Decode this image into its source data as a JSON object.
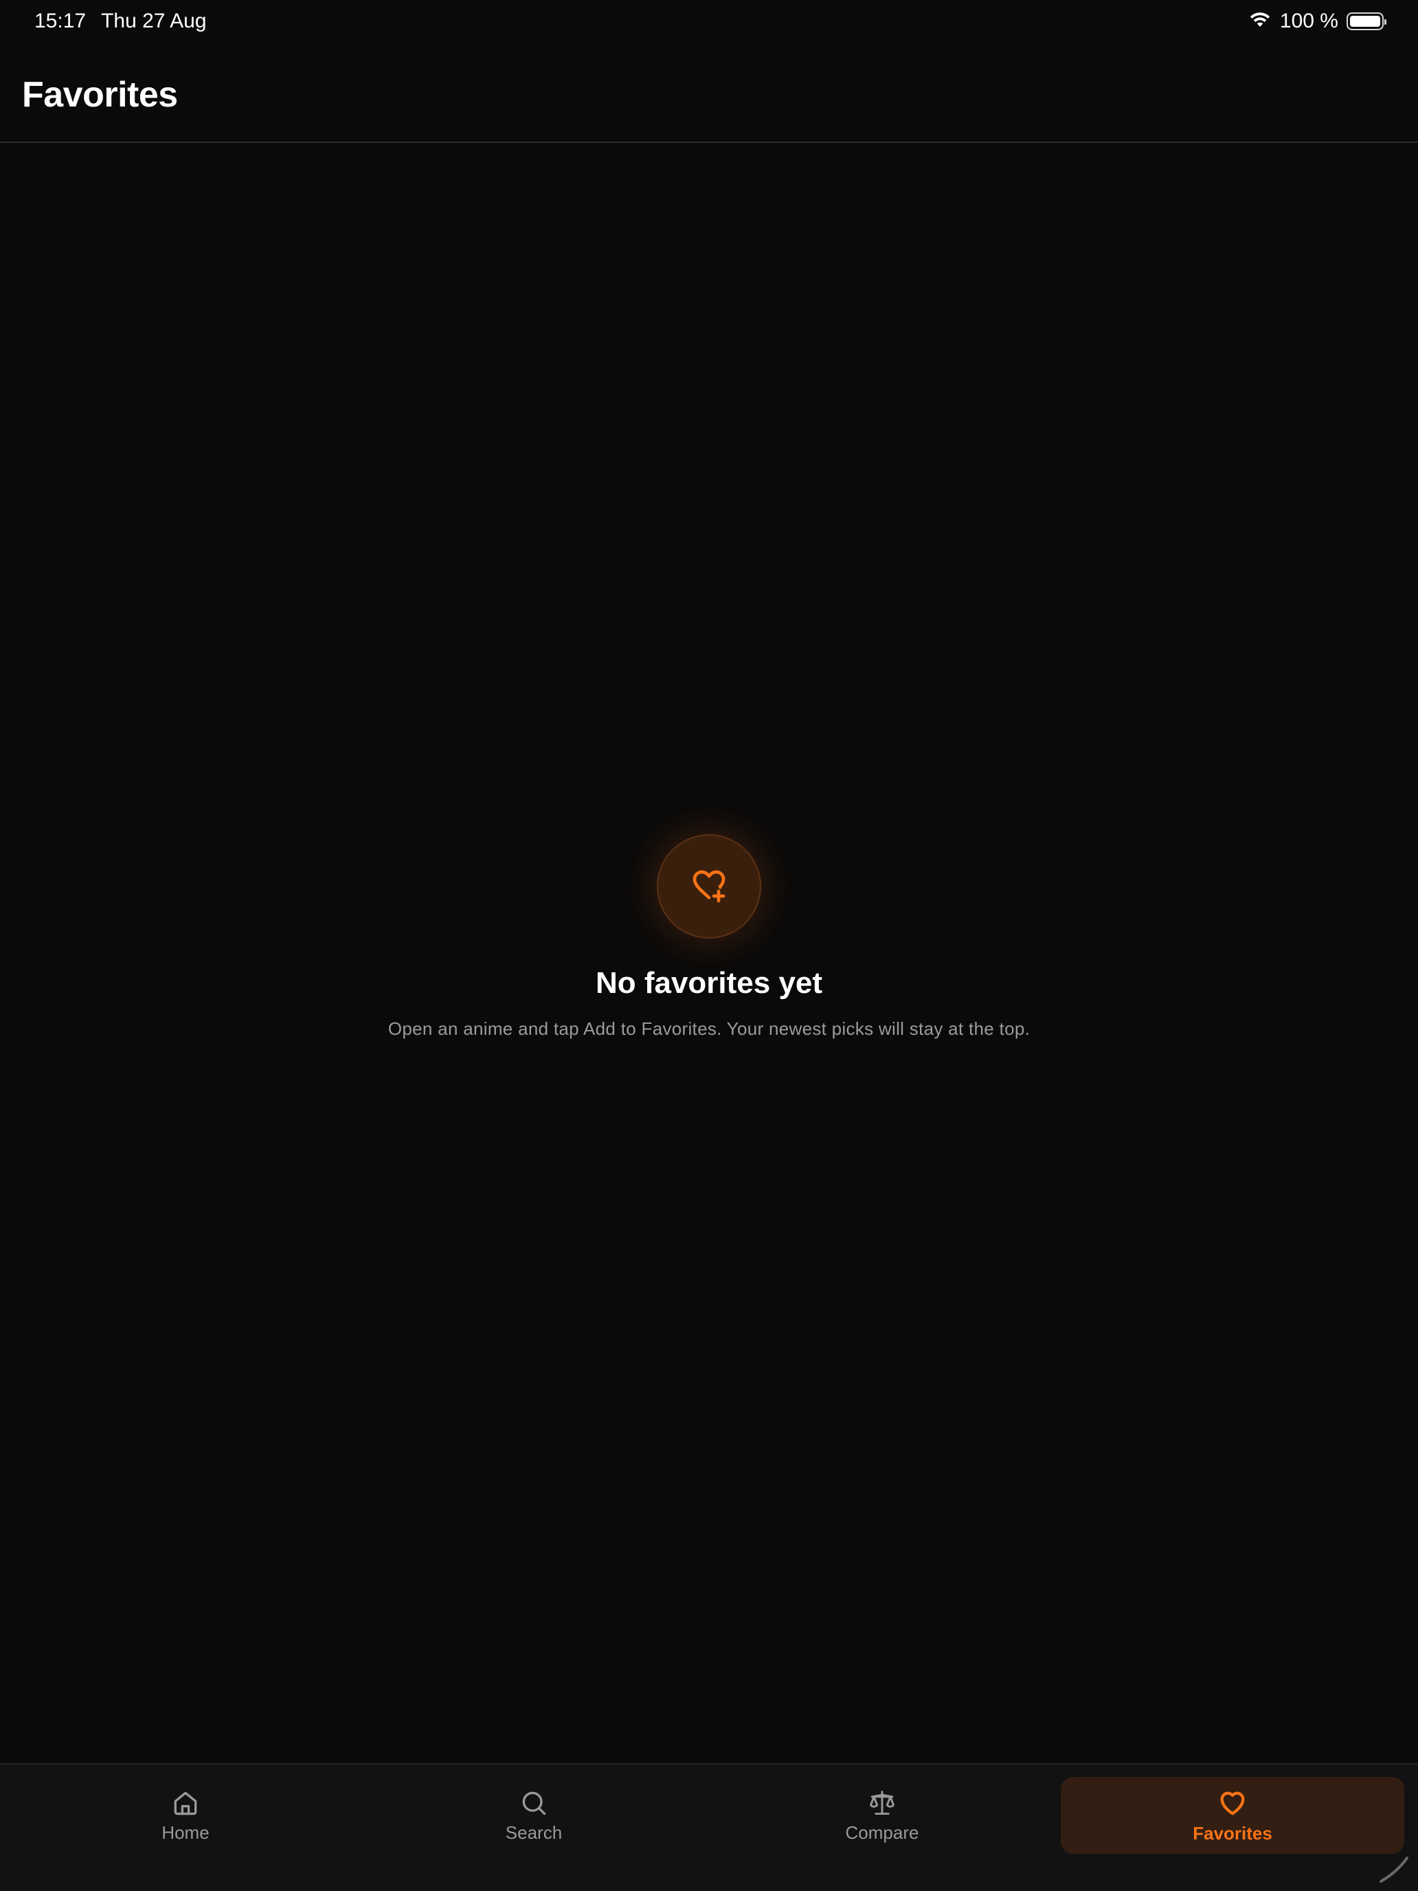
{
  "status_bar": {
    "time": "15:17",
    "date": "Thu 27 Aug",
    "battery_text": "100 %",
    "battery_level": 1.0,
    "wifi_icon": "wifi-icon",
    "battery_icon": "battery-icon"
  },
  "header": {
    "title": "Favorites"
  },
  "empty_state": {
    "icon": "heart-plus-icon",
    "title": "No favorites yet",
    "description": "Open an anime and tap Add to Favorites. Your newest picks will stay at the top."
  },
  "tab_bar": {
    "tabs": [
      {
        "label": "Home",
        "icon": "home-icon",
        "active": false
      },
      {
        "label": "Search",
        "icon": "search-icon",
        "active": false
      },
      {
        "label": "Compare",
        "icon": "scale-icon",
        "active": false
      },
      {
        "label": "Favorites",
        "icon": "heart-icon",
        "active": true
      }
    ]
  },
  "colors": {
    "background": "#0a0a0a",
    "accent": "#f97316",
    "active_tab_bg": "#321e12",
    "muted_text": "#9a9a9a"
  }
}
